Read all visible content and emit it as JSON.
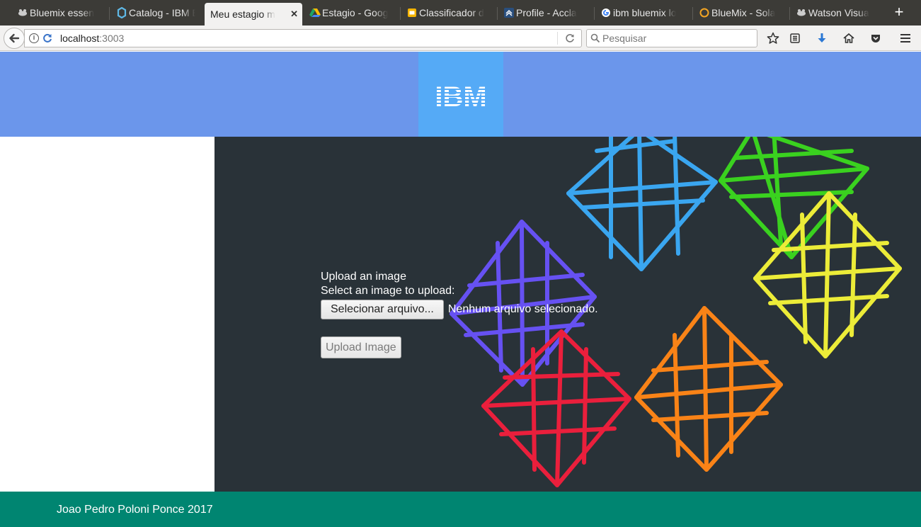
{
  "browser": {
    "tabs": [
      {
        "label": "Bluemix essen",
        "icon": "bluemix-icon",
        "active": false
      },
      {
        "label": "Catalog - IBM B",
        "icon": "catalog-icon",
        "active": false
      },
      {
        "label": "Meu estagio mi",
        "icon": "none",
        "active": true
      },
      {
        "label": "Estagio - Goog",
        "icon": "google-drive-icon",
        "active": false
      },
      {
        "label": "Classificador d",
        "icon": "google-slides-icon",
        "active": false
      },
      {
        "label": "Profile - Accla",
        "icon": "acclaim-icon",
        "active": false
      },
      {
        "label": "ibm bluemix lo",
        "icon": "google-icon",
        "active": false
      },
      {
        "label": "BlueMix - Sola",
        "icon": "circle-icon",
        "active": false
      },
      {
        "label": "Watson Visua",
        "icon": "bluemix-icon",
        "active": false
      }
    ],
    "url": {
      "host": "localhost",
      "port": ":3003"
    },
    "search_placeholder": "Pesquisar"
  },
  "header": {
    "logo_text": "IBM"
  },
  "upload": {
    "title": "Upload an image",
    "prompt": "Select an image to upload:",
    "choose_button": "Selecionar arquivo...",
    "file_status": "Nenhum arquivo selecionado.",
    "submit_button": "Upload Image"
  },
  "footer": {
    "text": "Joao Pedro Poloni Ponce 2017"
  },
  "colors": {
    "header_bg": "#6b96eb",
    "logo_bg": "#55aaf6",
    "hero_bg": "#293238",
    "footer_bg": "#008571",
    "gem_blue": "#3aa6f0",
    "gem_green": "#3ad11f",
    "gem_yellow": "#ecec38",
    "gem_purple": "#6651f2",
    "gem_red": "#ea1f3c",
    "gem_orange": "#f98317"
  }
}
